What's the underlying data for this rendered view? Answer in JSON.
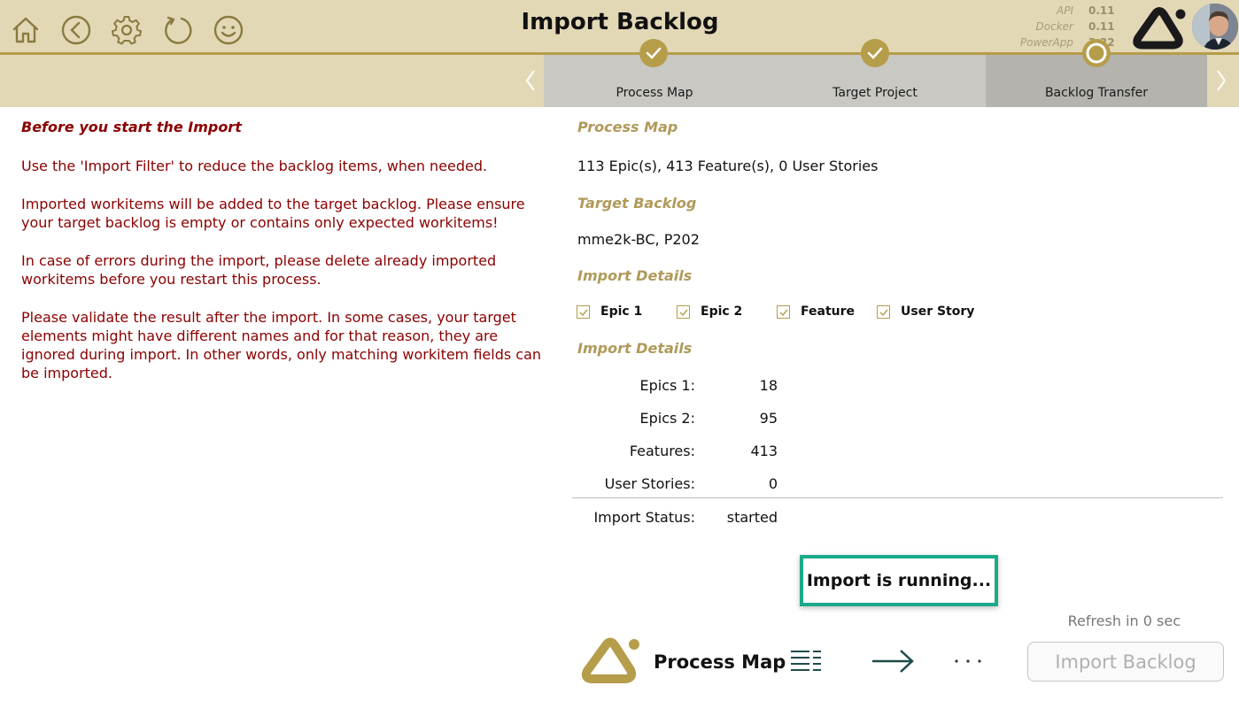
{
  "header": {
    "title": "Import Backlog",
    "icons": [
      "home-icon",
      "back-icon",
      "gear-icon",
      "refresh-icon",
      "smiley-icon"
    ],
    "versions": [
      {
        "label": "API",
        "value": "0.11"
      },
      {
        "label": "Docker",
        "value": "0.11"
      },
      {
        "label": "PowerApp",
        "value": "2.32"
      }
    ],
    "accent_color": "#b59d4a",
    "background_color": "#e3d8b6"
  },
  "stepper": {
    "steps": [
      {
        "label": "Process Map",
        "state": "done"
      },
      {
        "label": "Target Project",
        "state": "done"
      },
      {
        "label": "Backlog Transfer",
        "state": "current"
      }
    ]
  },
  "instructions": {
    "heading": "Before you start the Import",
    "paragraphs": [
      "Use the 'Import Filter' to reduce the backlog items, when needed.",
      "Imported workitems will be added to the target backlog. Please ensure your target backlog is empty or contains only expected workitems!",
      "In case of errors during the import, please delete already imported workitems before you restart this process.",
      "Please validate the result after the import. In some cases, your target elements might have different names and for that reason, they are ignored during import. In other words, only matching workitem fields can be imported."
    ],
    "text_color": "#8b0000"
  },
  "summary": {
    "process_map_title": "Process Map",
    "process_map_value": "113 Epic(s), 413 Feature(s), 0 User Stories",
    "target_backlog_title": "Target Backlog",
    "target_backlog_value": "mme2k-BC, P202",
    "import_details_title": "Import Details",
    "checkboxes": [
      {
        "label": "Epic 1",
        "checked": true
      },
      {
        "label": "Epic 2",
        "checked": true
      },
      {
        "label": "Feature",
        "checked": true
      },
      {
        "label": "User Story",
        "checked": true
      }
    ],
    "import_details_title_2": "Import Details",
    "stats": [
      {
        "label": "Epics 1:",
        "value": "18"
      },
      {
        "label": "Epics 2:",
        "value": "95"
      },
      {
        "label": "Features:",
        "value": "413"
      },
      {
        "label": "User Stories:",
        "value": "0"
      }
    ],
    "status_label": "Import Status:",
    "status_value": "started"
  },
  "running_message": "Import is running...",
  "running_border_color": "#1aaa8a",
  "refresh_text": "Refresh in 0 sec",
  "footer": {
    "brand_label": "Process Map",
    "import_button_label": "Import Backlog",
    "icons": [
      "list-icon",
      "arrow-right-icon",
      "more-dots-icon"
    ]
  }
}
